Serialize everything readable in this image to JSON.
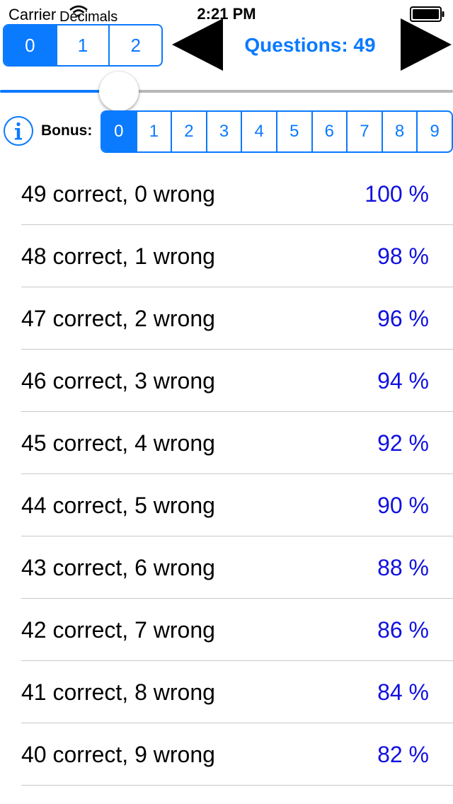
{
  "status_bar": {
    "carrier": "Carrier",
    "time": "2:21 PM"
  },
  "decimals": {
    "label": "Decimals",
    "options": [
      "0",
      "1",
      "2"
    ],
    "selected": "0"
  },
  "questions": {
    "label": "Questions: 49"
  },
  "slider": {
    "value_fraction": 0.26
  },
  "bonus": {
    "label": "Bonus:",
    "options": [
      "0",
      "1",
      "2",
      "3",
      "4",
      "5",
      "6",
      "7",
      "8",
      "9"
    ],
    "selected": "0"
  },
  "results": [
    {
      "label": "49 correct, 0 wrong",
      "percent": "100 %"
    },
    {
      "label": "48 correct, 1 wrong",
      "percent": "98 %"
    },
    {
      "label": "47 correct, 2 wrong",
      "percent": "96 %"
    },
    {
      "label": "46 correct, 3 wrong",
      "percent": "94 %"
    },
    {
      "label": "45 correct, 4 wrong",
      "percent": "92 %"
    },
    {
      "label": "44 correct, 5 wrong",
      "percent": "90 %"
    },
    {
      "label": "43 correct, 6 wrong",
      "percent": "88 %"
    },
    {
      "label": "42 correct, 7 wrong",
      "percent": "86 %"
    },
    {
      "label": "41 correct, 8 wrong",
      "percent": "84 %"
    },
    {
      "label": "40 correct, 9 wrong",
      "percent": "82 %"
    }
  ],
  "icons": {
    "wifi": "wifi-icon",
    "battery": "battery-icon",
    "previous": "triangle-left-icon",
    "next": "triangle-right-icon",
    "info": "info-icon"
  },
  "colors": {
    "accent": "#0a7aff",
    "percent_text": "#1010e0",
    "separator": "#c8c7cc"
  }
}
